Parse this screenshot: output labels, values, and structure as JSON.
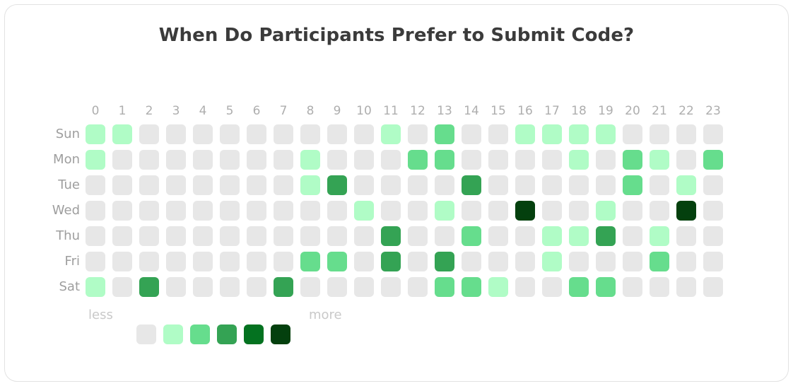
{
  "chart_data": {
    "type": "heatmap",
    "title": "When Do Participants Prefer to Submit Code?",
    "xlabel": "",
    "ylabel": "",
    "x_tick_labels": [
      "0",
      "1",
      "2",
      "3",
      "4",
      "5",
      "6",
      "7",
      "8",
      "9",
      "10",
      "11",
      "12",
      "13",
      "14",
      "15",
      "16",
      "17",
      "18",
      "19",
      "20",
      "21",
      "22",
      "23"
    ],
    "y_tick_labels": [
      "Sun",
      "Mon",
      "Tue",
      "Wed",
      "Thu",
      "Fri",
      "Sat"
    ],
    "grid": false,
    "legend_position": "bottom",
    "legend": {
      "low_label": "less",
      "high_label": "more",
      "levels": [
        0,
        1,
        2,
        3,
        4,
        5
      ]
    },
    "color_scale": [
      "#e7e7e7",
      "#b0fcc6",
      "#66dd8d",
      "#34a354",
      "#047220",
      "#04400e"
    ],
    "values": [
      [
        1,
        1,
        0,
        0,
        0,
        0,
        0,
        0,
        0,
        0,
        0,
        1,
        0,
        2,
        0,
        0,
        1,
        1,
        1,
        1,
        0,
        0,
        0,
        0
      ],
      [
        1,
        0,
        0,
        0,
        0,
        0,
        0,
        0,
        1,
        0,
        0,
        0,
        2,
        2,
        0,
        0,
        0,
        0,
        1,
        0,
        2,
        1,
        0,
        2
      ],
      [
        0,
        0,
        0,
        0,
        0,
        0,
        0,
        0,
        1,
        3,
        0,
        0,
        0,
        0,
        3,
        0,
        0,
        0,
        0,
        0,
        2,
        0,
        1,
        0
      ],
      [
        0,
        0,
        0,
        0,
        0,
        0,
        0,
        0,
        0,
        0,
        1,
        0,
        0,
        1,
        0,
        0,
        5,
        0,
        0,
        1,
        0,
        0,
        5,
        0
      ],
      [
        0,
        0,
        0,
        0,
        0,
        0,
        0,
        0,
        0,
        0,
        0,
        3,
        0,
        0,
        2,
        0,
        0,
        1,
        1,
        3,
        0,
        1,
        0,
        0
      ],
      [
        0,
        0,
        0,
        0,
        0,
        0,
        0,
        0,
        2,
        2,
        0,
        3,
        0,
        3,
        0,
        0,
        0,
        1,
        0,
        0,
        0,
        2,
        0,
        0
      ],
      [
        1,
        0,
        3,
        0,
        0,
        0,
        0,
        3,
        0,
        0,
        0,
        0,
        0,
        2,
        2,
        1,
        0,
        0,
        2,
        2,
        0,
        0,
        0,
        0
      ]
    ]
  }
}
